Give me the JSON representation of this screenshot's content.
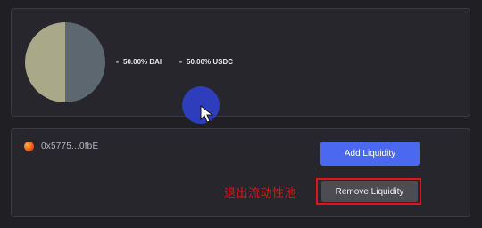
{
  "pool_chart": {
    "legend": [
      {
        "label": "50.00% DAI",
        "share": 0.5,
        "color": "#a9a98a"
      },
      {
        "label": "50.00% USDC",
        "share": 0.5,
        "color": "#5d6770"
      }
    ]
  },
  "position": {
    "address": "0x5775...0fbE",
    "icon": "token-icon"
  },
  "actions": {
    "add_label": "Add Liquidity",
    "remove_label": "Remove Liquidity"
  },
  "annotation": {
    "text": "退出流动性池",
    "color": "#e0141a"
  },
  "colors": {
    "background": "#1f1f24",
    "panel": "#26262c",
    "accent": "#4b68f0",
    "highlight": "#e0141a"
  }
}
